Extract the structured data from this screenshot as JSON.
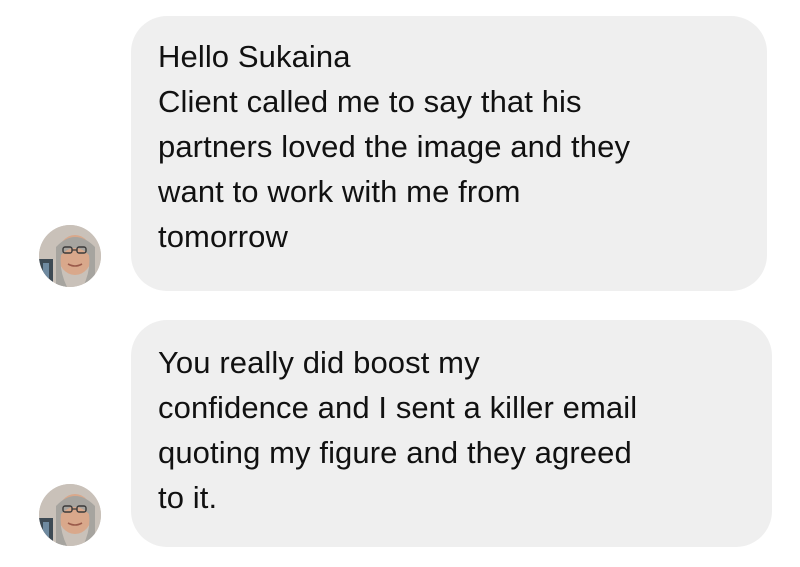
{
  "messages": [
    {
      "sender_avatar": "profile-photo-avatar",
      "lines": [
        "Hello Sukaina",
        "Client called me to say that his",
        "partners loved the image and they",
        "want to work with me from",
        "tomorrow"
      ]
    },
    {
      "sender_avatar": "profile-photo-avatar",
      "lines": [
        "You really did boost my",
        "confidence and I sent a killer email",
        "quoting my figure and they agreed",
        "to it."
      ]
    }
  ],
  "colors": {
    "bubble_background": "#efefef",
    "text": "#111111",
    "page_background": "#ffffff"
  }
}
